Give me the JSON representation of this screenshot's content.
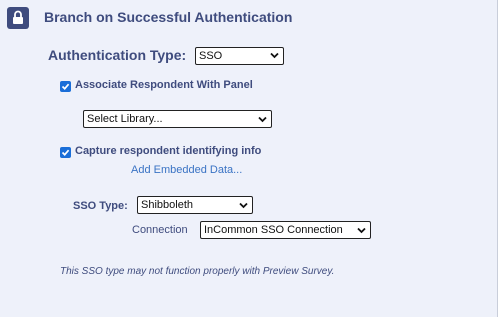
{
  "header": {
    "title": "Branch on Successful Authentication",
    "icon": "lock-icon"
  },
  "auth_type": {
    "label": "Authentication Type:",
    "value": "SSO"
  },
  "associate_panel": {
    "label": "Associate Respondent With Panel",
    "checked": true
  },
  "library": {
    "value": "Select Library..."
  },
  "capture_info": {
    "label": "Capture respondent identifying info",
    "checked": true,
    "link": "Add Embedded Data..."
  },
  "sso_type": {
    "label": "SSO Type:",
    "value": "Shibboleth"
  },
  "connection": {
    "label": "Connection",
    "value": "InCommon SSO Connection"
  },
  "note": "This SSO type may not function properly with Preview Survey.",
  "colors": {
    "accent": "#3f4c7e",
    "checkbox": "#1a6ed8",
    "link": "#3a73c4",
    "background": "#eef1fa"
  }
}
